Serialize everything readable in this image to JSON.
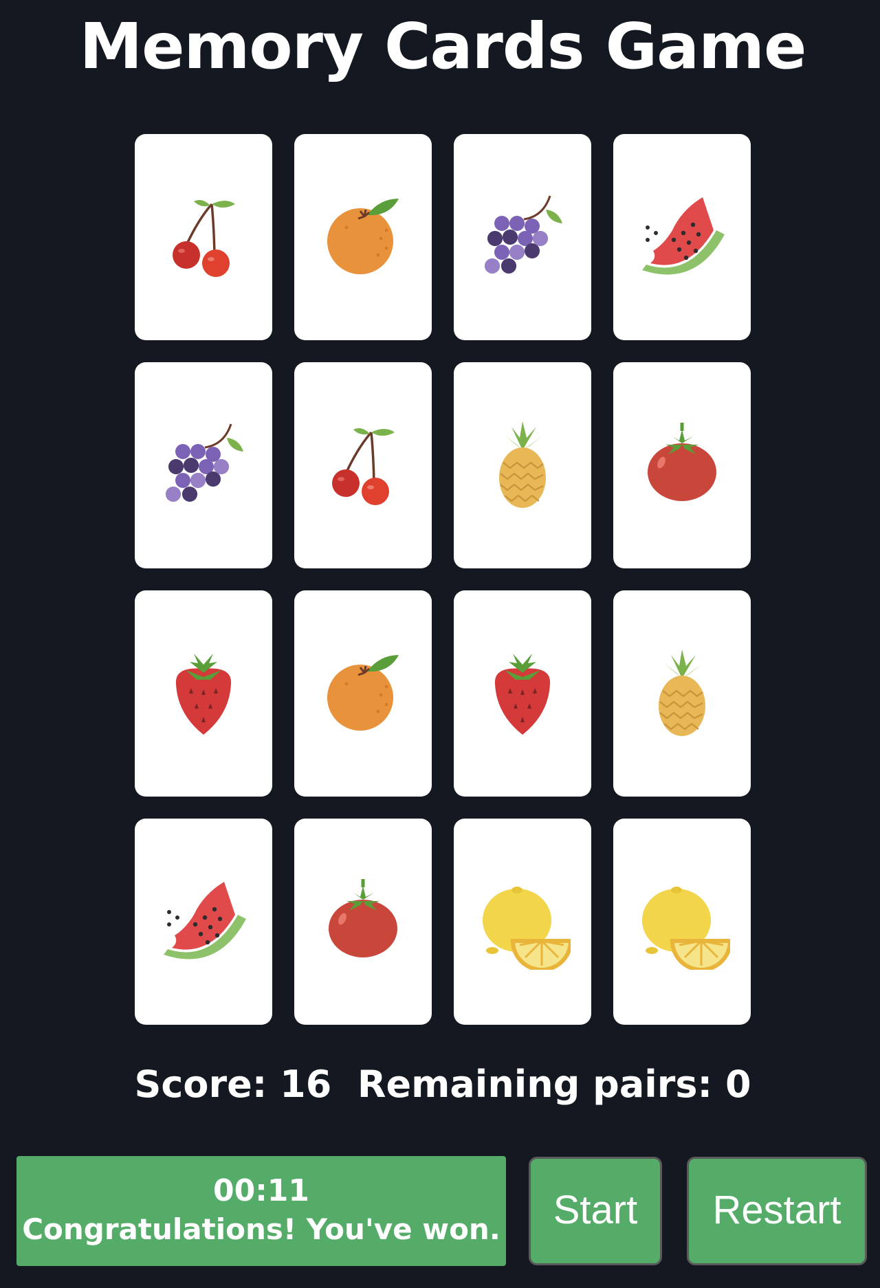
{
  "title": "Memory Cards Game",
  "cards": [
    {
      "fruit": "cherries"
    },
    {
      "fruit": "orange"
    },
    {
      "fruit": "grapes"
    },
    {
      "fruit": "watermelon"
    },
    {
      "fruit": "grapes"
    },
    {
      "fruit": "cherries"
    },
    {
      "fruit": "pineapple"
    },
    {
      "fruit": "tomato"
    },
    {
      "fruit": "strawberry"
    },
    {
      "fruit": "orange"
    },
    {
      "fruit": "strawberry"
    },
    {
      "fruit": "pineapple"
    },
    {
      "fruit": "watermelon"
    },
    {
      "fruit": "tomato"
    },
    {
      "fruit": "lemon"
    },
    {
      "fruit": "lemon"
    }
  ],
  "stats": {
    "score_label": "Score:",
    "score": 16,
    "remaining_label": "Remaining pairs:",
    "remaining": 0
  },
  "status": {
    "timer": "00:11",
    "message": "Congratulations! You've won."
  },
  "buttons": {
    "start": "Start",
    "restart": "Restart"
  },
  "colors": {
    "background": "#141820",
    "card": "#ffffff",
    "accent_green": "#55ac68"
  }
}
